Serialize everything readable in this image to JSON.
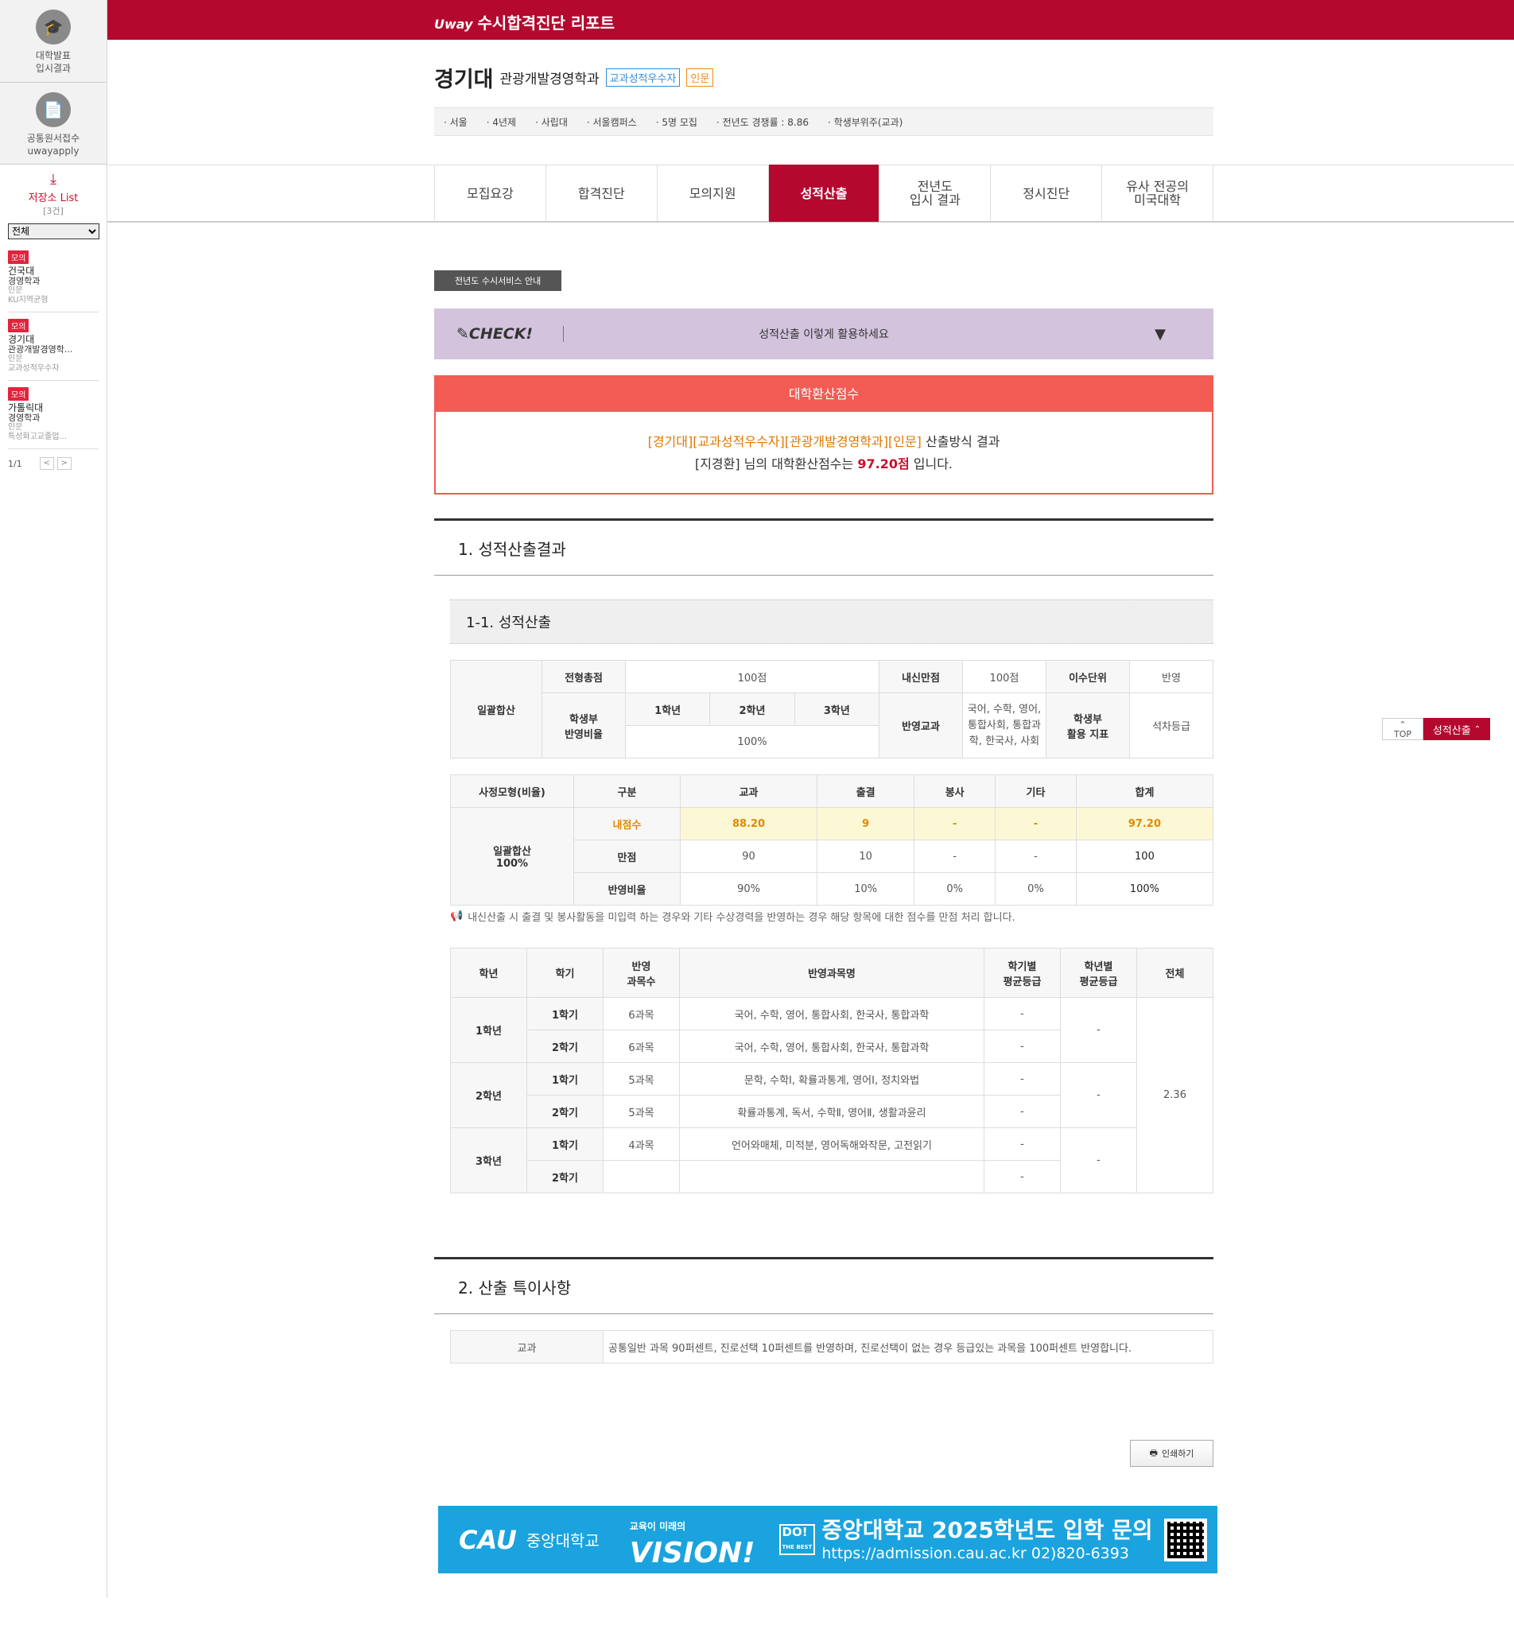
{
  "sidebar": {
    "blocks": [
      {
        "icon": "graduation-cap-icon",
        "label": "대학발표\n입시결과"
      },
      {
        "icon": "document-icon",
        "label": "공통원서접수\nuwayapply"
      }
    ],
    "store_title": "저장소 List",
    "store_count": "[3건]",
    "select_value": "전체",
    "items": [
      {
        "badge": "모의",
        "univ": "건국대",
        "major": "경영학과",
        "type": "인문",
        "track": "KU지역균형"
      },
      {
        "badge": "모의",
        "univ": "경기대",
        "major": "관광개발경영학...",
        "type": "인문",
        "track": "교과성적우수자"
      },
      {
        "badge": "모의",
        "univ": "가톨릭대",
        "major": "경영학과",
        "type": "인문",
        "track": "특성화고교졸업..."
      }
    ],
    "pager": {
      "current": "1",
      "total": "/1",
      "prev": "<",
      "next": ">"
    }
  },
  "topbar": {
    "brand": "Uway",
    "title": "수시합격진단 리포트"
  },
  "header": {
    "univ": "경기대",
    "major": "관광개발경영학과",
    "tag1": "교과성적우수자",
    "tag2": "인문",
    "info": [
      "서울",
      "4년제",
      "사립대",
      "서울캠퍼스",
      "5명 모집",
      "전년도 경쟁률 : 8.86",
      "학생부위주(교과)"
    ]
  },
  "tabs": [
    "모집요강",
    "합격진단",
    "모의지원",
    "성적산출",
    "전년도\n입시 결과",
    "정시진단",
    "유사 전공의\n미국대학"
  ],
  "active_tab": 3,
  "notice_button": "전년도 수시서비스 안내",
  "check_bar": {
    "logo": "CHECK!",
    "text": "성적산출 이렇게 활용하세요",
    "arrow": "▼"
  },
  "score": {
    "head": "대학환산점수",
    "line1_tag": "[경기대][교과성적우수자][관광개발경영학과][인문]",
    "line1_rest": " 산출방식 결과",
    "line2_pre": "[지경환] 님의 대학환산점수는 ",
    "line2_score": "97.20점",
    "line2_post": " 입니다."
  },
  "section1": {
    "title": "1. 성적산출결과",
    "sub": "1-1. 성적산출"
  },
  "table1": {
    "row_label": "일괄합산",
    "total_label": "전형총점",
    "total_value": "100점",
    "naesin_label": "내신만점",
    "naesin_value": "100점",
    "isu_label": "이수단위",
    "isu_value": "반영",
    "ratio_label": "학생부\n반영비율",
    "grades": [
      "1학년",
      "2학년",
      "3학년"
    ],
    "ratio_value": "100%",
    "subjects_label": "반영교과",
    "subjects_value": "국어, 수학, 영어, 통합사회, 통합과학, 한국사, 사회",
    "indicator_label": "학생부\n활용 지표",
    "indicator_value": "석차등급"
  },
  "table2": {
    "headers": [
      "사정모형(비율)",
      "구분",
      "교과",
      "출결",
      "봉사",
      "기타",
      "합계"
    ],
    "model": "일괄합산\n100%",
    "rows": [
      {
        "label": "내점수",
        "values": [
          "88.20",
          "9",
          "-",
          "-",
          "97.20"
        ]
      },
      {
        "label": "만점",
        "values": [
          "90",
          "10",
          "-",
          "-",
          "100"
        ]
      },
      {
        "label": "반영비율",
        "values": [
          "90%",
          "10%",
          "0%",
          "0%",
          "100%"
        ]
      }
    ],
    "note": "내신산출 시 출결 및 봉사활동을 미입력 하는 경우와 기타 수상경력을 반영하는 경우 해당 항목에 대한 점수를 만점 처리 합니다."
  },
  "table3": {
    "headers": [
      "학년",
      "학기",
      "반영\n과목수",
      "반영과목명",
      "학기별\n평균등급",
      "학년별\n평균등급",
      "전체"
    ],
    "years": [
      {
        "year": "1학년",
        "year_avg": "-",
        "terms": [
          {
            "term": "1학기",
            "count": "6과목",
            "subjects": "국어, 수학, 영어, 통합사회, 한국사, 통합과학",
            "avg": "-"
          },
          {
            "term": "2학기",
            "count": "6과목",
            "subjects": "국어, 수학, 영어, 통합사회, 한국사, 통합과학",
            "avg": "-"
          }
        ]
      },
      {
        "year": "2학년",
        "year_avg": "-",
        "terms": [
          {
            "term": "1학기",
            "count": "5과목",
            "subjects": "문학, 수학Ⅰ, 확률과통계, 영어Ⅰ, 정치와법",
            "avg": "-"
          },
          {
            "term": "2학기",
            "count": "5과목",
            "subjects": "확률과통계, 독서, 수학Ⅱ, 영어Ⅱ, 생활과윤리",
            "avg": "-"
          }
        ]
      },
      {
        "year": "3학년",
        "year_avg": "-",
        "terms": [
          {
            "term": "1학기",
            "count": "4과목",
            "subjects": "언어와매체, 미적분, 영어독해와작문, 고전읽기",
            "avg": "-"
          },
          {
            "term": "2학기",
            "count": "",
            "subjects": "",
            "avg": "-"
          }
        ]
      }
    ],
    "overall": "2.36"
  },
  "section2": {
    "title": "2. 산출 특이사항"
  },
  "table4": {
    "label": "교과",
    "text": "공통일반 과목 90퍼센트, 진로선택 10퍼센트를 반영하며, 진로선택이 없는 경우 등급있는 과목을 100퍼센트 반영합니다."
  },
  "print_label": "인쇄하기",
  "banner": {
    "cau": "CAU",
    "name": "중앙대학교",
    "slogan": "교육이 미래의",
    "vision": "VISION!",
    "do_badge": "DO!",
    "do_sub": "THE BEST",
    "main": "중앙대학교 2025학년도 입학 문의",
    "url": "https://admission.cau.ac.kr 02)820-6393"
  },
  "float": {
    "top": "TOP",
    "score": "성적산출"
  },
  "colors": {
    "brand": "#b5082e",
    "score_head": "#f25c54",
    "check_bar": "#d3c3dd",
    "banner": "#1aa3de"
  }
}
